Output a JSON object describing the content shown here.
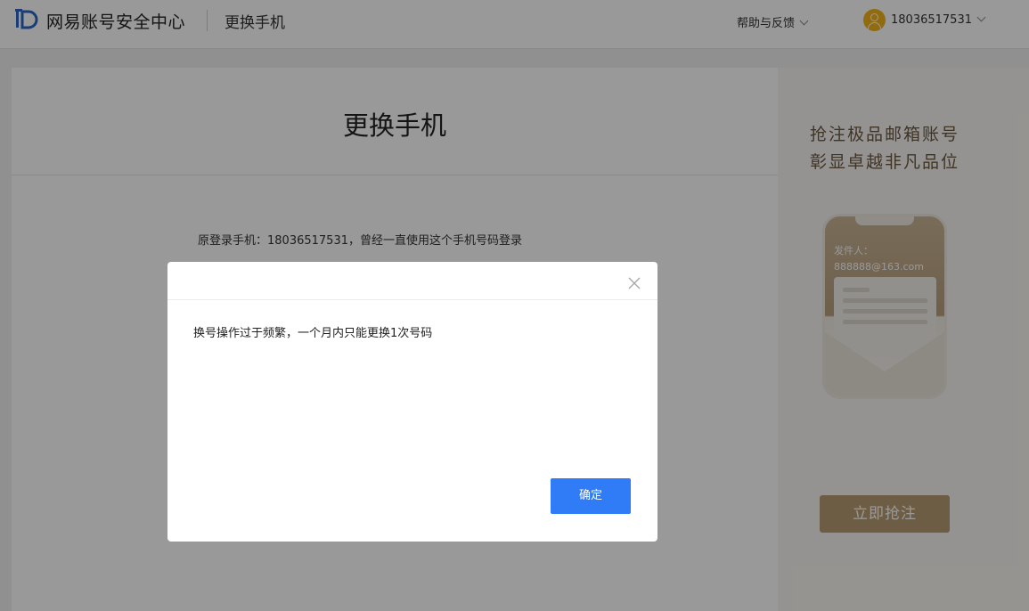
{
  "header": {
    "brand": "网易账号安全中心",
    "subtitle": "更换手机",
    "help_label": "帮助与反馈",
    "username": "18036517531"
  },
  "main": {
    "title": "更换手机",
    "info_text": "原登录手机：18036517531，曾经一直使用这个手机号码登录"
  },
  "ad": {
    "line1": "抢注极品邮箱账号",
    "line2": "彰显卓越非凡品位",
    "sender_label": "发件人：",
    "sender_email": "888888@163.com",
    "button_label": "立即抢注"
  },
  "modal": {
    "message": "换号操作过于频繁，一个月内只能更换1次号码",
    "confirm_label": "确定"
  },
  "colors": {
    "primary": "#2f7cf6",
    "avatar": "#f2b21c",
    "ad_button": "#b89c74",
    "logo": "#2a66c7"
  },
  "icons": [
    "logo-icon",
    "chevron-down-icon",
    "avatar-icon",
    "close-icon"
  ]
}
